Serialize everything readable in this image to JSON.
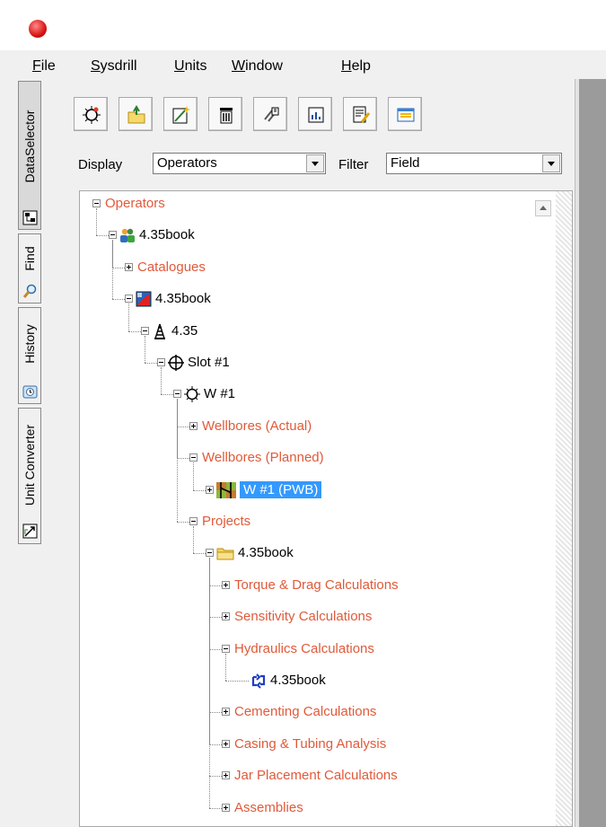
{
  "menu": {
    "items": [
      {
        "key": "F",
        "rest": "ile"
      },
      {
        "key": "S",
        "rest": "ysdrill"
      },
      {
        "key": "U",
        "rest": "nits"
      },
      {
        "key": "W",
        "rest": "indow"
      },
      {
        "key": "H",
        "rest": "elp"
      }
    ]
  },
  "side_tabs": [
    "DataSelector",
    "Find",
    "History",
    "Unit Converter"
  ],
  "toolbar_icons": [
    "new-well-icon",
    "open-folder-icon",
    "new-document-icon",
    "delete-icon",
    "link-icon",
    "report-icon",
    "edit-icon",
    "window-icon"
  ],
  "display": {
    "label": "Display",
    "value": "Operators"
  },
  "filter": {
    "label": "Filter",
    "value": "Field"
  },
  "tree": [
    {
      "label": "Operators",
      "type": "cat",
      "level": 0,
      "expander": "minus",
      "icon": ""
    },
    {
      "label": "4.35book",
      "type": "item",
      "level": 1,
      "expander": "minus",
      "icon": "company-icon"
    },
    {
      "label": "Catalogues",
      "type": "cat",
      "level": 2,
      "expander": "plus",
      "icon": ""
    },
    {
      "label": "4.35book",
      "type": "item",
      "level": 2,
      "expander": "minus",
      "icon": "field-icon"
    },
    {
      "label": "4.35",
      "type": "item",
      "level": 3,
      "expander": "minus",
      "icon": "site-rig-icon"
    },
    {
      "label": "Slot #1",
      "type": "item",
      "level": 4,
      "expander": "minus",
      "icon": "slot-icon"
    },
    {
      "label": "W #1",
      "type": "item",
      "level": 5,
      "expander": "minus",
      "icon": "well-icon"
    },
    {
      "label": "Wellbores (Actual)",
      "type": "cat",
      "level": 6,
      "expander": "plus",
      "icon": ""
    },
    {
      "label": "Wellbores (Planned)",
      "type": "cat",
      "level": 6,
      "expander": "minus",
      "icon": ""
    },
    {
      "label": "W #1 (PWB)",
      "type": "sel",
      "level": 7,
      "expander": "plus",
      "icon": "wellbore-icon"
    },
    {
      "label": "Projects",
      "type": "cat",
      "level": 6,
      "expander": "minus",
      "icon": ""
    },
    {
      "label": "4.35book",
      "type": "item",
      "level": 7,
      "expander": "minus",
      "icon": "project-folder-icon"
    },
    {
      "label": "Torque & Drag Calculations",
      "type": "cat",
      "level": 8,
      "expander": "plus",
      "icon": ""
    },
    {
      "label": "Sensitivity Calculations",
      "type": "cat",
      "level": 8,
      "expander": "plus",
      "icon": ""
    },
    {
      "label": "Hydraulics Calculations",
      "type": "cat",
      "level": 8,
      "expander": "minus",
      "icon": ""
    },
    {
      "label": "4.35book",
      "type": "item",
      "level": 9,
      "expander": "",
      "icon": "hydraulics-case-icon"
    },
    {
      "label": "Cementing Calculations",
      "type": "cat",
      "level": 8,
      "expander": "plus",
      "icon": ""
    },
    {
      "label": "Casing & Tubing Analysis",
      "type": "cat",
      "level": 8,
      "expander": "plus",
      "icon": ""
    },
    {
      "label": "Jar Placement Calculations",
      "type": "cat",
      "level": 8,
      "expander": "plus",
      "icon": ""
    },
    {
      "label": "Assemblies",
      "type": "cat",
      "level": 8,
      "expander": "plus",
      "icon": ""
    }
  ]
}
